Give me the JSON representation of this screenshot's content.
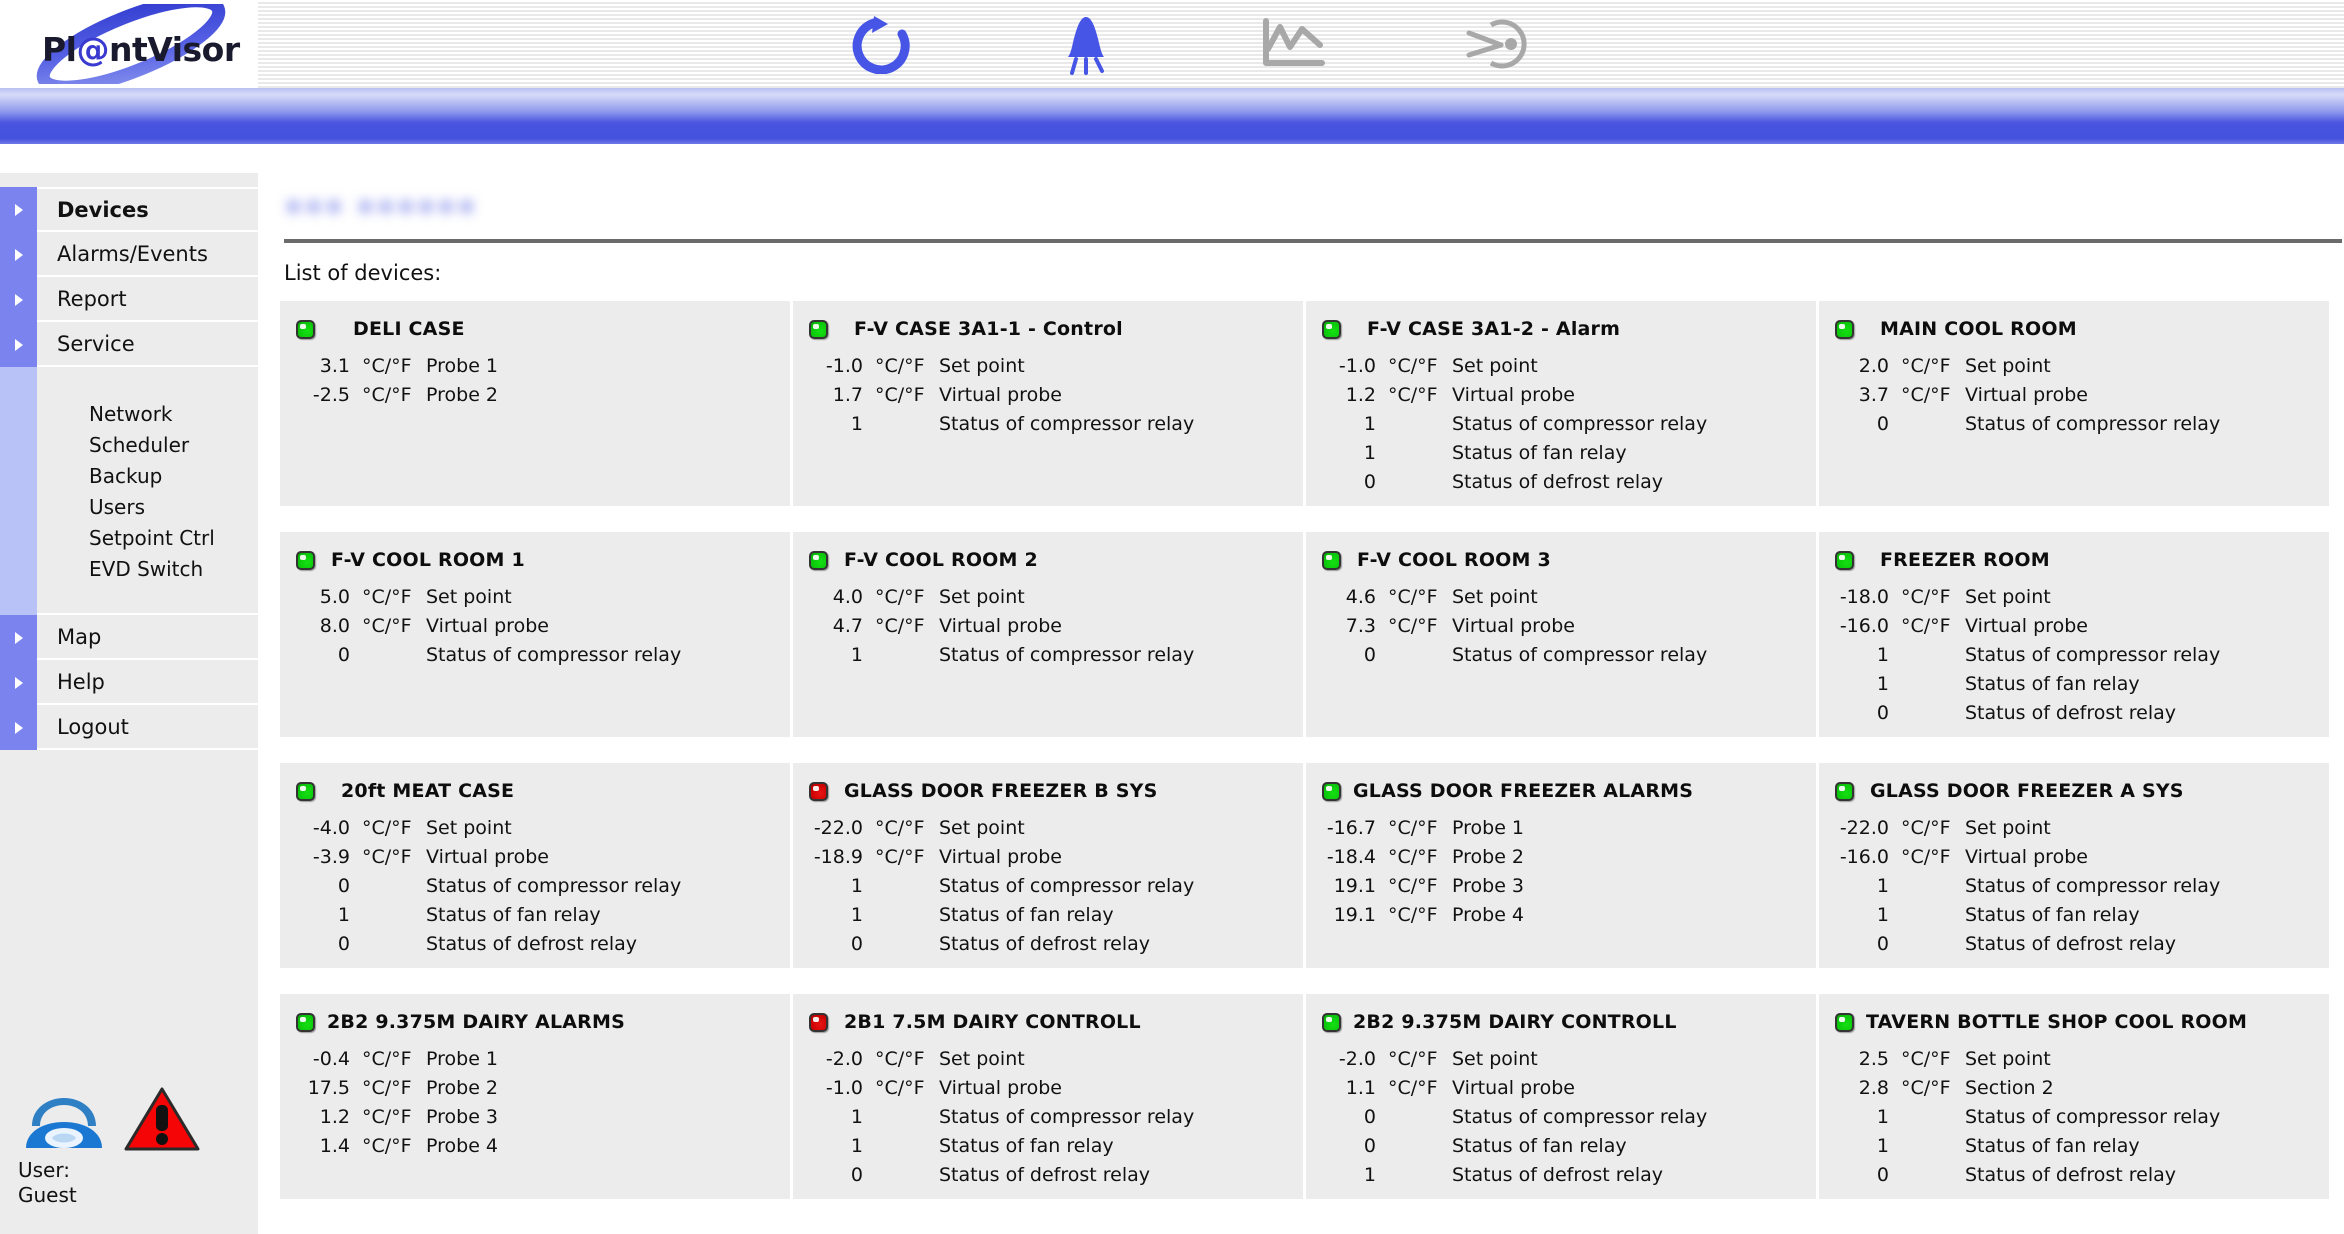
{
  "header": {
    "logo_text_1": "Pl",
    "logo_text_at": "@",
    "logo_text_2": "ntVisor",
    "toolbar": [
      {
        "name": "refresh-icon",
        "label": "Refresh",
        "state": "active"
      },
      {
        "name": "alarm-bell-icon",
        "label": "Alarms",
        "state": "active"
      },
      {
        "name": "chart-icon",
        "label": "Graphs",
        "state": "disabled"
      },
      {
        "name": "history-icon",
        "label": "History",
        "state": "disabled"
      }
    ]
  },
  "sidebar": {
    "items": [
      {
        "label": "Devices",
        "active": true
      },
      {
        "label": "Alarms/Events",
        "active": false
      },
      {
        "label": "Report",
        "active": false
      },
      {
        "label": "Service",
        "active": false
      }
    ],
    "service_children": [
      {
        "label": "Network"
      },
      {
        "label": "Scheduler"
      },
      {
        "label": "Backup"
      },
      {
        "label": "Users"
      },
      {
        "label": "Setpoint Ctrl"
      },
      {
        "label": "EVD Switch"
      }
    ],
    "items_bottom": [
      {
        "label": "Map",
        "active": false
      },
      {
        "label": "Help",
        "active": false
      },
      {
        "label": "Logout",
        "active": false
      }
    ],
    "footer": {
      "phone_icon": "telephone-icon",
      "alarm_icon": "warning-triangle-icon",
      "user_label": "User:",
      "user_name": "Guest"
    }
  },
  "main": {
    "site_title_redacted": "••• ••••••",
    "list_label": "List of devices:",
    "unit": "°C/°F",
    "devices": [
      {
        "name": "DELI CASE",
        "status": "green",
        "title_indent": "indent-lg",
        "rows": [
          {
            "value": "3.1",
            "unit": "°C/°F",
            "desc": "Probe 1"
          },
          {
            "value": "-2.5",
            "unit": "°C/°F",
            "desc": "Probe 2"
          }
        ]
      },
      {
        "name": "F-V CASE 3A1-1 - Control",
        "status": "green",
        "title_indent": "indent-md",
        "rows": [
          {
            "value": "-1.0",
            "unit": "°C/°F",
            "desc": "Set point"
          },
          {
            "value": "1.7",
            "unit": "°C/°F",
            "desc": "Virtual probe"
          },
          {
            "value": "1",
            "unit": "",
            "desc": "Status of compressor relay"
          }
        ]
      },
      {
        "name": "F-V CASE 3A1-2 - Alarm",
        "status": "green",
        "title_indent": "indent-md",
        "rows": [
          {
            "value": "-1.0",
            "unit": "°C/°F",
            "desc": "Set point"
          },
          {
            "value": "1.2",
            "unit": "°C/°F",
            "desc": "Virtual probe"
          },
          {
            "value": "1",
            "unit": "",
            "desc": "Status of compressor relay"
          },
          {
            "value": "1",
            "unit": "",
            "desc": "Status of fan relay"
          },
          {
            "value": "0",
            "unit": "",
            "desc": "Status of defrost relay"
          }
        ]
      },
      {
        "name": "MAIN COOL ROOM",
        "status": "green",
        "title_indent": "indent-md",
        "rows": [
          {
            "value": "2.0",
            "unit": "°C/°F",
            "desc": "Set point"
          },
          {
            "value": "3.7",
            "unit": "°C/°F",
            "desc": "Virtual probe"
          },
          {
            "value": "0",
            "unit": "",
            "desc": "Status of compressor relay"
          }
        ]
      },
      {
        "name": "F-V COOL ROOM 1",
        "status": "green",
        "title_indent": "indent-sm",
        "rows": [
          {
            "value": "5.0",
            "unit": "°C/°F",
            "desc": "Set point"
          },
          {
            "value": "8.0",
            "unit": "°C/°F",
            "desc": "Virtual probe"
          },
          {
            "value": "0",
            "unit": "",
            "desc": "Status of compressor relay"
          }
        ]
      },
      {
        "name": "F-V COOL ROOM 2",
        "status": "green",
        "title_indent": "indent-sm",
        "rows": [
          {
            "value": "4.0",
            "unit": "°C/°F",
            "desc": "Set point"
          },
          {
            "value": "4.7",
            "unit": "°C/°F",
            "desc": "Virtual probe"
          },
          {
            "value": "1",
            "unit": "",
            "desc": "Status of compressor relay"
          }
        ]
      },
      {
        "name": "F-V COOL ROOM 3",
        "status": "green",
        "title_indent": "indent-sm",
        "rows": [
          {
            "value": "4.6",
            "unit": "°C/°F",
            "desc": "Set point"
          },
          {
            "value": "7.3",
            "unit": "°C/°F",
            "desc": "Virtual probe"
          },
          {
            "value": "0",
            "unit": "",
            "desc": "Status of compressor relay"
          }
        ]
      },
      {
        "name": "FREEZER ROOM",
        "status": "green",
        "title_indent": "indent-md",
        "rows": [
          {
            "value": "-18.0",
            "unit": "°C/°F",
            "desc": "Set point"
          },
          {
            "value": "-16.0",
            "unit": "°C/°F",
            "desc": "Virtual probe"
          },
          {
            "value": "1",
            "unit": "",
            "desc": "Status of compressor relay"
          },
          {
            "value": "1",
            "unit": "",
            "desc": "Status of fan relay"
          },
          {
            "value": "0",
            "unit": "",
            "desc": "Status of defrost relay"
          }
        ]
      },
      {
        "name": "20ft MEAT CASE",
        "status": "green",
        "title_indent": "indent-md",
        "rows": [
          {
            "value": "-4.0",
            "unit": "°C/°F",
            "desc": "Set point"
          },
          {
            "value": "-3.9",
            "unit": "°C/°F",
            "desc": "Virtual probe"
          },
          {
            "value": "0",
            "unit": "",
            "desc": "Status of compressor relay"
          },
          {
            "value": "1",
            "unit": "",
            "desc": "Status of fan relay"
          },
          {
            "value": "0",
            "unit": "",
            "desc": "Status of defrost relay"
          }
        ]
      },
      {
        "name": "GLASS DOOR FREEZER B SYS",
        "status": "red",
        "title_indent": "indent-sm",
        "rows": [
          {
            "value": "-22.0",
            "unit": "°C/°F",
            "desc": "Set point"
          },
          {
            "value": "-18.9",
            "unit": "°C/°F",
            "desc": "Virtual probe"
          },
          {
            "value": "1",
            "unit": "",
            "desc": "Status of compressor relay"
          },
          {
            "value": "1",
            "unit": "",
            "desc": "Status of fan relay"
          },
          {
            "value": "0",
            "unit": "",
            "desc": "Status of defrost relay"
          }
        ]
      },
      {
        "name": "GLASS DOOR FREEZER ALARMS",
        "status": "green",
        "title_indent": "",
        "rows": [
          {
            "value": "-16.7",
            "unit": "°C/°F",
            "desc": "Probe 1"
          },
          {
            "value": "-18.4",
            "unit": "°C/°F",
            "desc": "Probe 2"
          },
          {
            "value": "19.1",
            "unit": "°C/°F",
            "desc": "Probe 3"
          },
          {
            "value": "19.1",
            "unit": "°C/°F",
            "desc": "Probe 4"
          }
        ]
      },
      {
        "name": "GLASS DOOR FREEZER A SYS",
        "status": "green",
        "title_indent": "indent-sm",
        "rows": [
          {
            "value": "-22.0",
            "unit": "°C/°F",
            "desc": "Set point"
          },
          {
            "value": "-16.0",
            "unit": "°C/°F",
            "desc": "Virtual probe"
          },
          {
            "value": "1",
            "unit": "",
            "desc": "Status of compressor relay"
          },
          {
            "value": "1",
            "unit": "",
            "desc": "Status of fan relay"
          },
          {
            "value": "0",
            "unit": "",
            "desc": "Status of defrost relay"
          }
        ]
      },
      {
        "name": "2B2 9.375M DAIRY ALARMS",
        "status": "green",
        "title_indent": "",
        "rows": [
          {
            "value": "-0.4",
            "unit": "°C/°F",
            "desc": "Probe 1"
          },
          {
            "value": "17.5",
            "unit": "°C/°F",
            "desc": "Probe 2"
          },
          {
            "value": "1.2",
            "unit": "°C/°F",
            "desc": "Probe 3"
          },
          {
            "value": "1.4",
            "unit": "°C/°F",
            "desc": "Probe 4"
          }
        ]
      },
      {
        "name": "2B1 7.5M DAIRY CONTROLL",
        "status": "red",
        "title_indent": "indent-sm",
        "rows": [
          {
            "value": "-2.0",
            "unit": "°C/°F",
            "desc": "Set point"
          },
          {
            "value": "-1.0",
            "unit": "°C/°F",
            "desc": "Virtual probe"
          },
          {
            "value": "1",
            "unit": "",
            "desc": "Status of compressor relay"
          },
          {
            "value": "1",
            "unit": "",
            "desc": "Status of fan relay"
          },
          {
            "value": "0",
            "unit": "",
            "desc": "Status of defrost relay"
          }
        ]
      },
      {
        "name": "2B2 9.375M DAIRY CONTROLL",
        "status": "green",
        "title_indent": "",
        "rows": [
          {
            "value": "-2.0",
            "unit": "°C/°F",
            "desc": "Set point"
          },
          {
            "value": "1.1",
            "unit": "°C/°F",
            "desc": "Virtual probe"
          },
          {
            "value": "0",
            "unit": "",
            "desc": "Status of compressor relay"
          },
          {
            "value": "0",
            "unit": "",
            "desc": "Status of fan relay"
          },
          {
            "value": "1",
            "unit": "",
            "desc": "Status of defrost relay"
          }
        ]
      },
      {
        "name": "TAVERN BOTTLE SHOP COOL ROOM",
        "status": "green",
        "title_indent": "",
        "rows": [
          {
            "value": "2.5",
            "unit": "°C/°F",
            "desc": "Set point"
          },
          {
            "value": "2.8",
            "unit": "°C/°F",
            "desc": "Section 2"
          },
          {
            "value": "1",
            "unit": "",
            "desc": "Status of compressor relay"
          },
          {
            "value": "1",
            "unit": "",
            "desc": "Status of fan relay"
          },
          {
            "value": "0",
            "unit": "",
            "desc": "Status of defrost relay"
          }
        ]
      }
    ]
  },
  "colors": {
    "accent_blue": "#4351dd",
    "sidebar_arrow": "#7b84ee",
    "sidebar_sub": "#b9c2f7",
    "card_bg": "#ececec",
    "led_green": "#0bc50b",
    "led_red": "#cc0000"
  }
}
